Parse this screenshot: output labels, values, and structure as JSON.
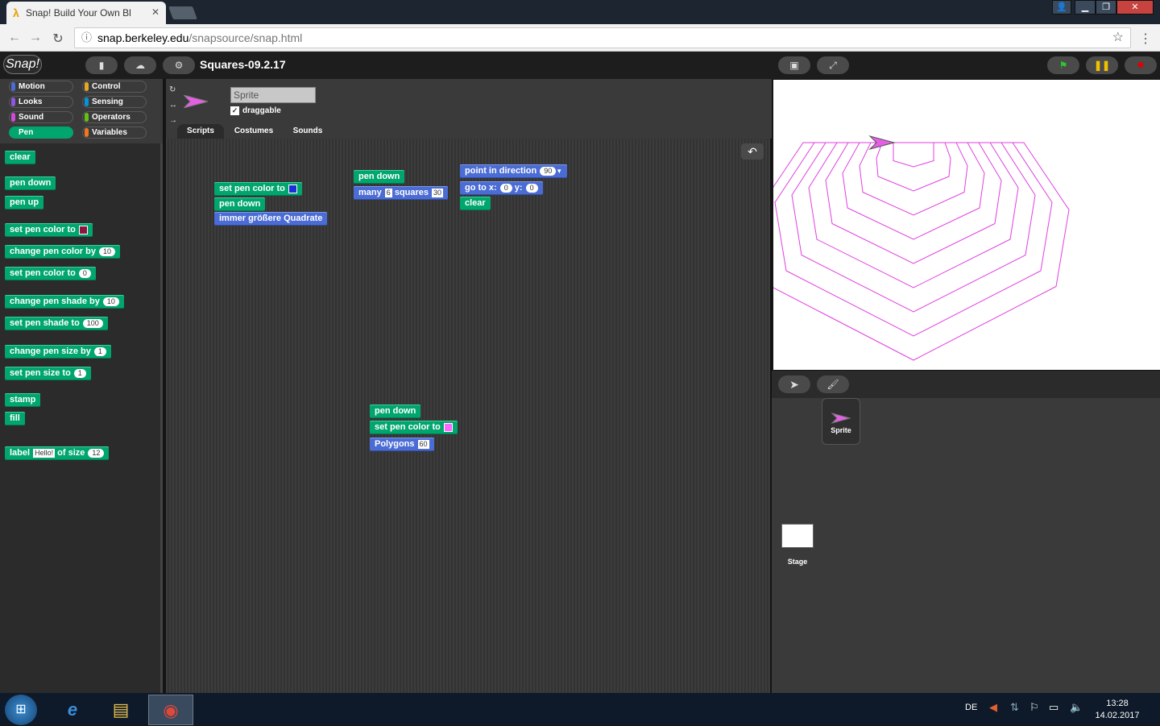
{
  "browser": {
    "tab_title": "Snap! Build Your Own Bl",
    "url_domain": "snap.berkeley.edu",
    "url_path": "/snapsource/snap.html"
  },
  "snap": {
    "logo": "Snap!",
    "project_title": "Squares-09.2.17",
    "categories": [
      {
        "label": "Motion",
        "color": "#4a6cd4"
      },
      {
        "label": "Control",
        "color": "#e6a822"
      },
      {
        "label": "Looks",
        "color": "#8f56e3"
      },
      {
        "label": "Sensing",
        "color": "#0494dc"
      },
      {
        "label": "Sound",
        "color": "#cf4ad9"
      },
      {
        "label": "Operators",
        "color": "#62c213"
      },
      {
        "label": "Pen",
        "color": "#00a66e"
      },
      {
        "label": "Variables",
        "color": "#f3761d"
      }
    ],
    "palette": {
      "clear": "clear",
      "pen_down": "pen down",
      "pen_up": "pen up",
      "set_pen_color_to": "set pen color to",
      "change_pen_color_by": "change pen color by",
      "change_pen_color_by_value": "10",
      "set_pen_color_to_num": "set pen color to",
      "set_pen_color_to_num_value": "0",
      "change_pen_shade_by": "change pen shade by",
      "change_pen_shade_by_value": "10",
      "set_pen_shade_to": "set pen shade to",
      "set_pen_shade_to_value": "100",
      "change_pen_size_by": "change pen size by",
      "change_pen_size_by_value": "1",
      "set_pen_size_to": "set pen size to",
      "set_pen_size_to_value": "1",
      "stamp": "stamp",
      "fill": "fill",
      "label_prefix": "label",
      "label_text": "Hello!",
      "label_mid": "of size",
      "label_size": "12"
    },
    "sprite": {
      "name_placeholder": "Sprite",
      "draggable": "draggable",
      "tabs": [
        "Scripts",
        "Costumes",
        "Sounds"
      ]
    },
    "scripts": {
      "s1_a": "set pen color to",
      "s1_b": "pen down",
      "s1_c": "immer größere Quadrate",
      "s2_a": "pen down",
      "s2_b1": "many",
      "s2_b2": "6",
      "s2_b3": "squares",
      "s2_b4": "30",
      "s3_a": "point in direction",
      "s3_a_val": "90",
      "s3_b": "go to x:",
      "s3_b_x": "0",
      "s3_b_y_label": "y:",
      "s3_b_y": "0",
      "s3_c": "clear",
      "s4_a": "pen down",
      "s4_b": "set pen color to",
      "s4_c": "Polygons",
      "s4_c_val": "60"
    },
    "corral": {
      "sprite_label": "Sprite",
      "stage_label": "Stage"
    },
    "colors": {
      "pen": "#e040e0",
      "swatch_blue": "#1a2fd6",
      "swatch_maroon": "#8b1540",
      "swatch_pink": "#ff66ff"
    }
  },
  "taskbar": {
    "lang": "DE",
    "time": "13:28",
    "date": "14.02.2017"
  }
}
